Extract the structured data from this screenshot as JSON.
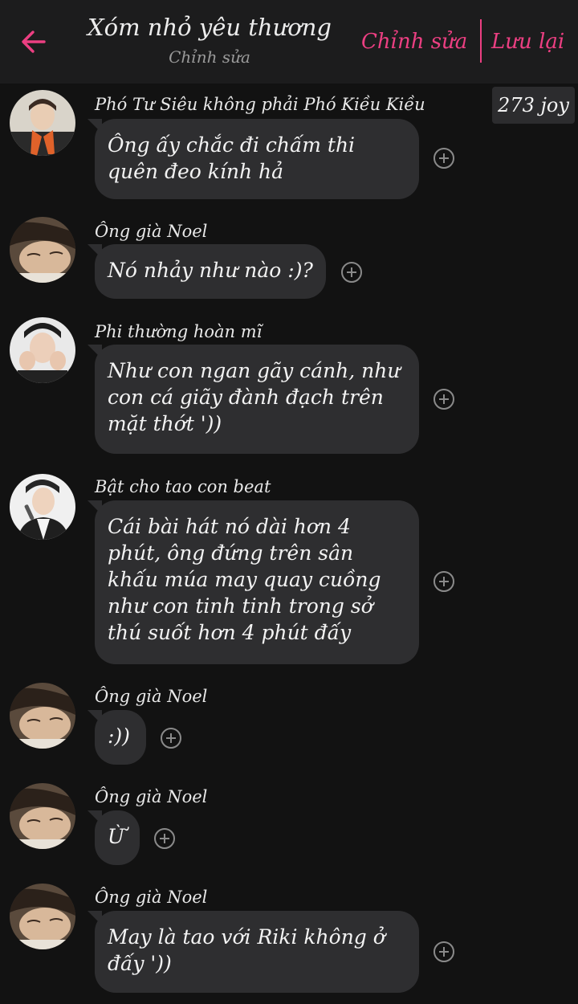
{
  "header": {
    "title": "Xóm nhỏ yêu thương",
    "subtitle": "Chỉnh sửa",
    "edit_label": "Chỉnh sửa",
    "save_label": "Lưu lại",
    "back_icon": "arrow-left-icon",
    "accent_color": "#ec3f82"
  },
  "joy_badge": "273 joy",
  "messages": [
    {
      "sender": "Phó Tư Siêu không phải Phó Kiều Kiều",
      "text": "Ông ấy chắc đi chấm thi quên đeo kính hả",
      "avatar": "avatar-orange-scarf"
    },
    {
      "sender": "Ông già Noel",
      "text": "Nó nhảy như nào :)?",
      "avatar": "avatar-sleeping-boy"
    },
    {
      "sender": "Phi thường hoàn mĩ",
      "text": "Như con ngan gãy cánh, như con cá giãy đành đạch trên mặt thớt '))",
      "avatar": "avatar-hands-face"
    },
    {
      "sender": "Bật cho tao con beat",
      "text": "Cái bài hát nó dài hơn 4 phút, ông đứng trên sân khấu múa may quay cuồng như con tinh tinh trong sở thú suốt hơn 4 phút đấy",
      "avatar": "avatar-microphone"
    },
    {
      "sender": "Ông già Noel",
      "text": ":))",
      "avatar": "avatar-sleeping-boy"
    },
    {
      "sender": "Ông già Noel",
      "text": "Ừ",
      "avatar": "avatar-sleeping-boy"
    },
    {
      "sender": "Ông già Noel",
      "text": "May là tao với Riki không ở đấy '))",
      "avatar": "avatar-sleeping-boy"
    }
  ]
}
